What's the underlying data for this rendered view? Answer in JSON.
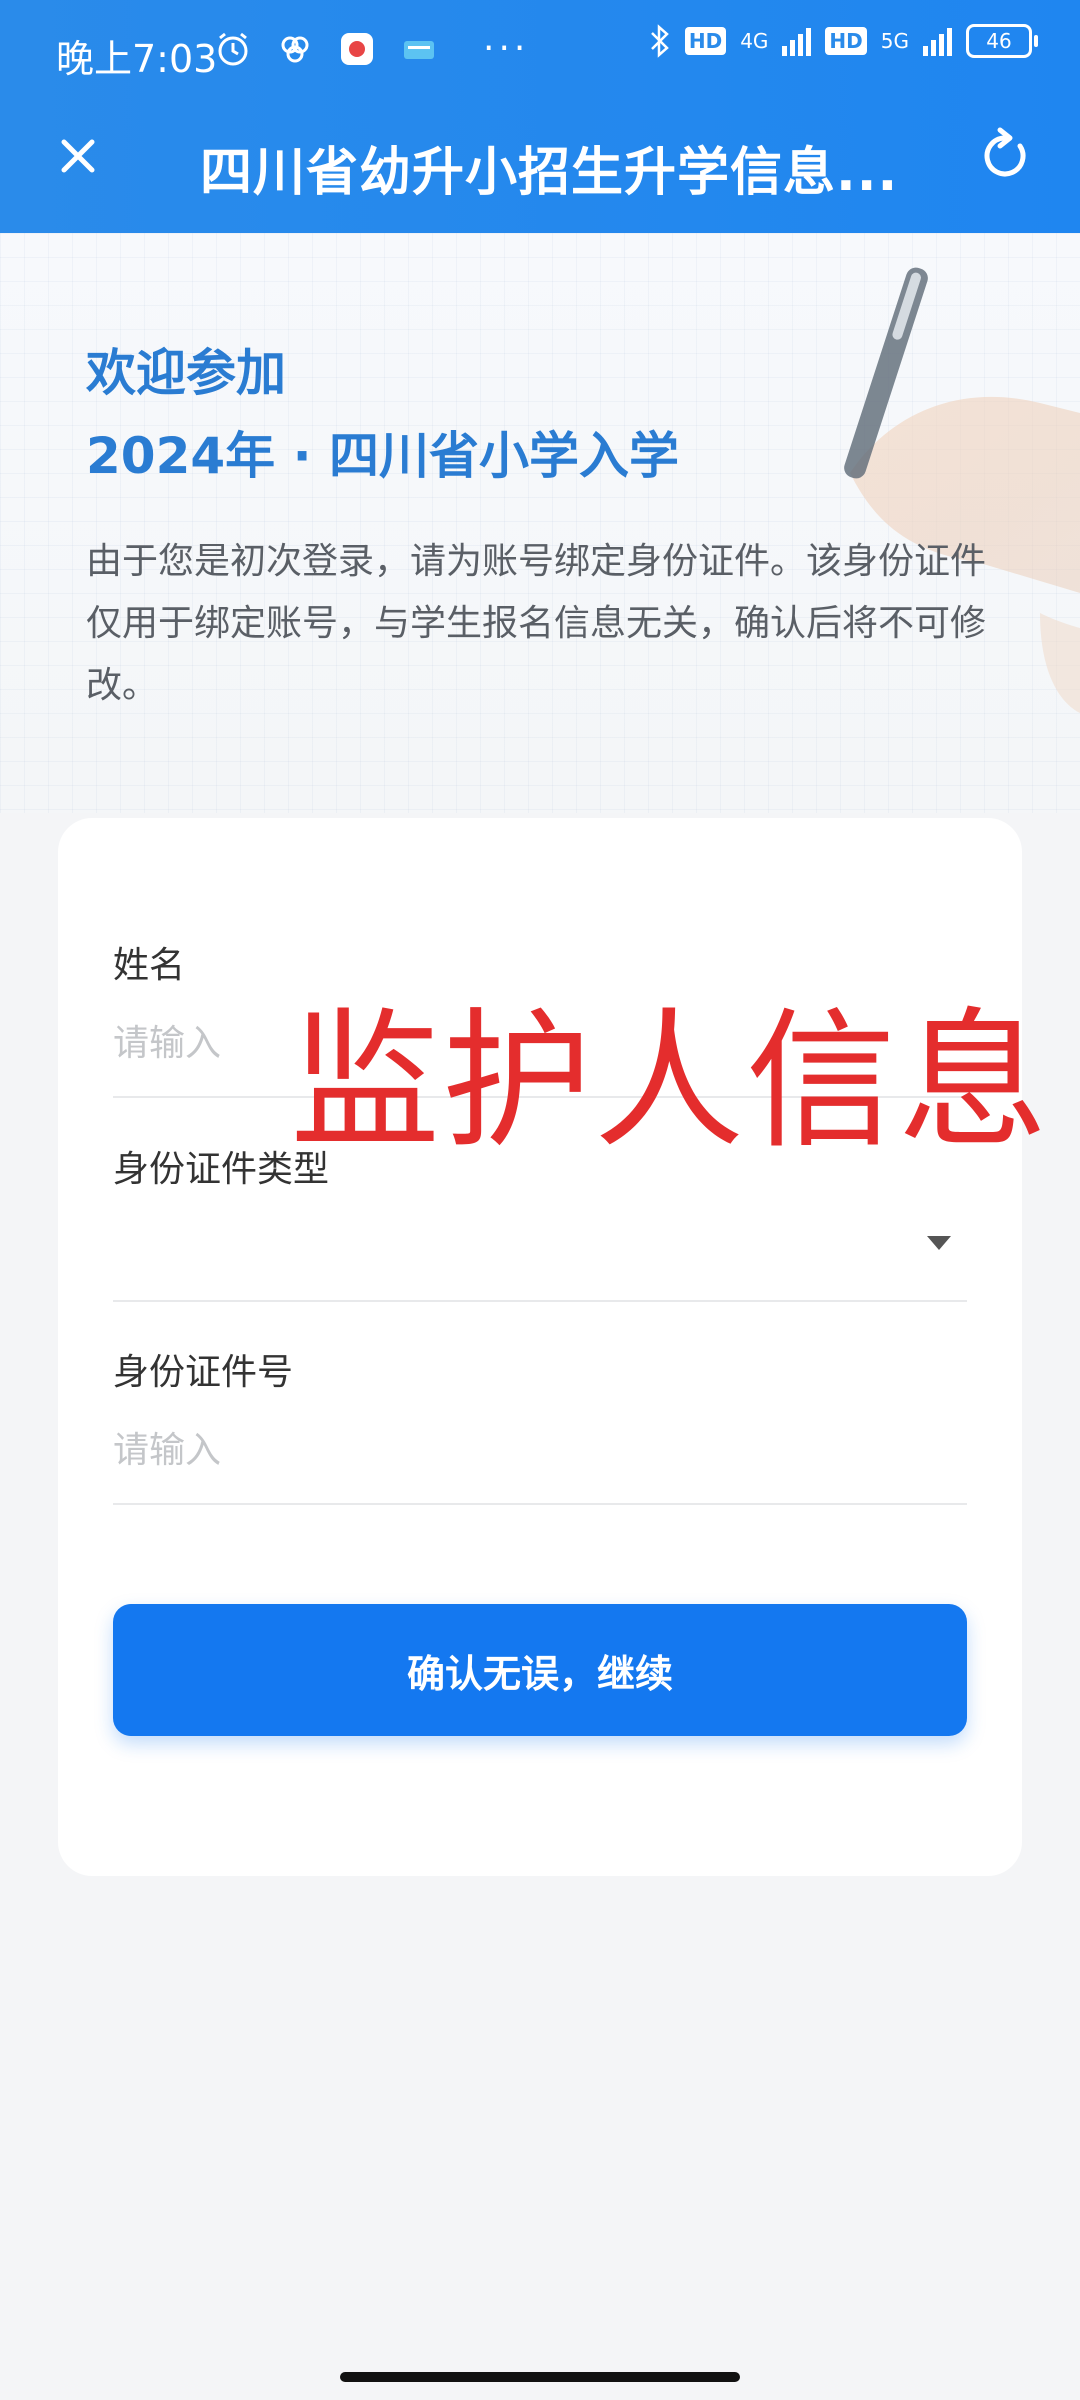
{
  "status_bar": {
    "time": "晚上7:03",
    "more": "···",
    "net1": "4G",
    "net2": "5G",
    "hd": "HD",
    "battery": "46"
  },
  "header": {
    "title": "四川省幼升小招生升学信息..."
  },
  "hero": {
    "welcome_line1": "欢迎参加",
    "welcome_line2": "2024年 · 四川省小学入学",
    "description": "由于您是初次登录，请为账号绑定身份证件。该身份证件仅用于绑定账号，与学生报名信息无关，确认后将不可修改。"
  },
  "form": {
    "name_label": "姓名",
    "name_placeholder": "请输入",
    "id_type_label": "身份证件类型",
    "id_type_value": "",
    "id_number_label": "身份证件号",
    "id_number_placeholder": "请输入",
    "confirm_label": "确认无误，继续"
  },
  "overlay": {
    "watermark_text": "监护人信息"
  },
  "colors": {
    "header_bg": "#2a8bea",
    "accent": "#1478f0",
    "watermark": "#e42d2d",
    "welcome_text": "#2a7cd2"
  }
}
